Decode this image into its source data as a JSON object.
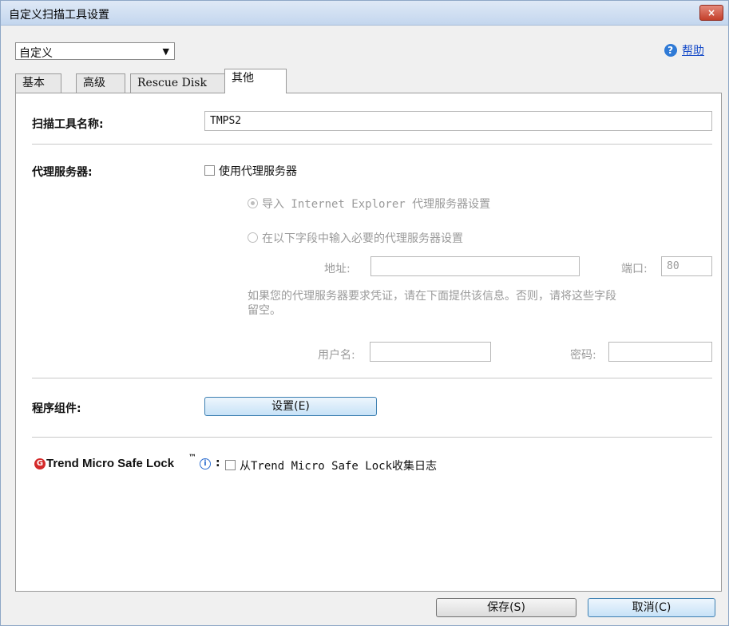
{
  "window": {
    "title": "自定义扫描工具设置",
    "close_glyph": "×"
  },
  "preset": {
    "selected": "自定义",
    "arrow": "▼"
  },
  "help": {
    "icon": "?",
    "label": "帮助"
  },
  "tabs": [
    {
      "label": "基本",
      "active": false
    },
    {
      "label": "高级",
      "active": false
    },
    {
      "label": "Rescue Disk",
      "active": false
    },
    {
      "label": "其他",
      "active": true
    }
  ],
  "scan_tool": {
    "label": "扫描工具名称:",
    "value": "TMPS2"
  },
  "proxy": {
    "label": "代理服务器:",
    "use_proxy_label": "使用代理服务器",
    "use_proxy_checked": false,
    "option_ie": "导入 Internet Explorer 代理服务器设置",
    "option_manual": "在以下字段中输入必要的代理服务器设置",
    "address_label": "地址:",
    "address_value": "",
    "port_label": "端口:",
    "port_value": "80",
    "credential_note_line1": "如果您的代理服务器要求凭证，请在下面提供该信息。否则，请将这些字段",
    "credential_note_line2": "留空。",
    "username_label": "用户名:",
    "username_value": "",
    "password_label": "密码:",
    "password_value": ""
  },
  "components": {
    "label": "程序组件:",
    "button": "设置(E)"
  },
  "safelock": {
    "logo_glyph": "G",
    "label": "Trend Micro Safe Lock",
    "tm": "™",
    "info_glyph": "i",
    "colon": ":",
    "checkbox_label": "从Trend Micro Safe Lock收集日志",
    "checked": false
  },
  "footer": {
    "save": "保存(S)",
    "cancel": "取消(C)"
  },
  "colors": {
    "accent": "#2f7ad6",
    "close": "#c3402b",
    "disabled": "#9a9a9a"
  }
}
